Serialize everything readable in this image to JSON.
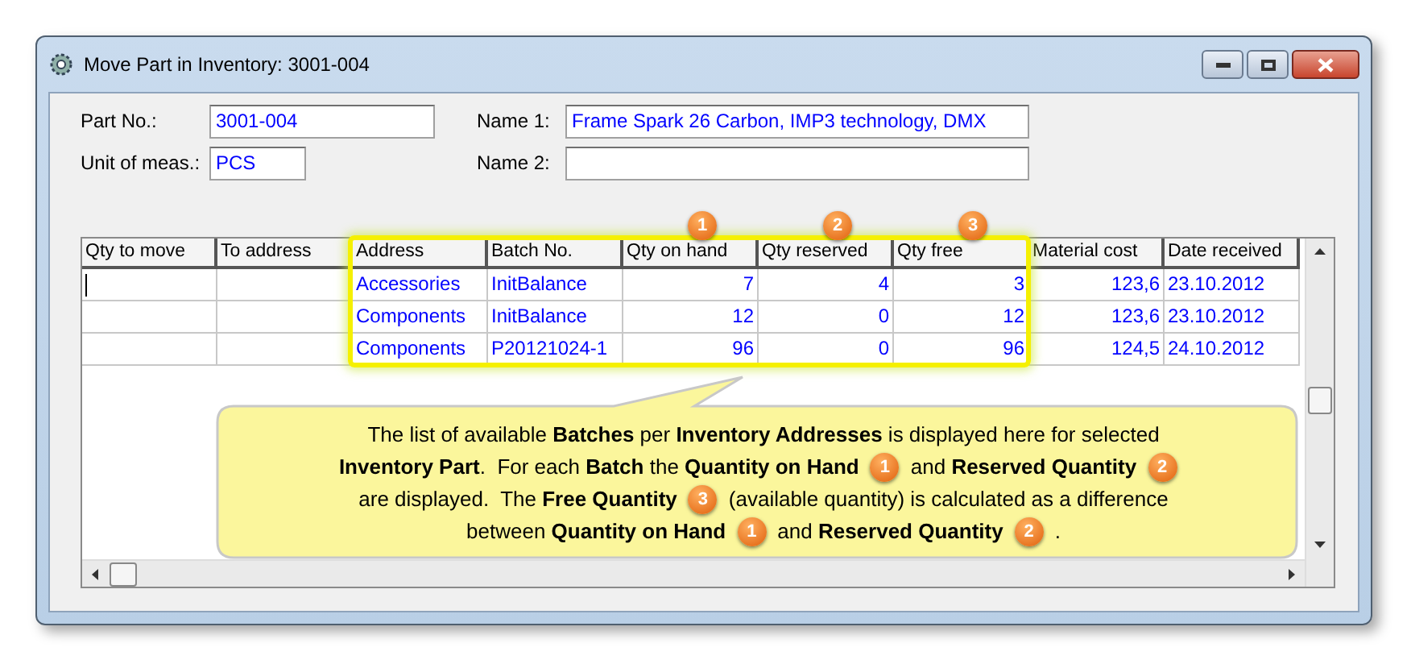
{
  "window": {
    "title": "Move Part in Inventory: 3001-004"
  },
  "left_fields": [
    {
      "label": "Part No.:",
      "value": "3001-004"
    },
    {
      "label": "Unit of meas.:",
      "value": "PCS"
    }
  ],
  "right_fields": [
    {
      "label": "Name 1:",
      "value": "Frame Spark 26 Carbon, IMP3 technology, DMX"
    },
    {
      "label": "Name 2:"
    }
  ],
  "table": {
    "columns": [
      {
        "label": "Qty to move",
        "kind": "text",
        "highlighted": false
      },
      {
        "label": "To address",
        "kind": "text",
        "highlighted": false
      },
      {
        "label": "Address",
        "kind": "text",
        "highlighted": true
      },
      {
        "label": "Batch No.",
        "kind": "text",
        "highlighted": true
      },
      {
        "label": "Qty on hand",
        "kind": "number",
        "highlighted": true,
        "badge": "1"
      },
      {
        "label": "Qty reserved",
        "kind": "number",
        "highlighted": true,
        "badge": "2"
      },
      {
        "label": "Qty free",
        "kind": "number",
        "highlighted": true,
        "badge": "3"
      },
      {
        "label": "Material cost",
        "kind": "number",
        "highlighted": false
      },
      {
        "label": "Date received",
        "kind": "text",
        "highlighted": false
      }
    ],
    "rows": [
      {
        "focused": true,
        "cells": [
          null,
          null,
          "Accessories",
          "InitBalance",
          "7",
          "4",
          "3",
          "123,6",
          "23.10.2012"
        ]
      },
      {
        "focused": false,
        "cells": [
          null,
          null,
          "Components",
          "InitBalance",
          "12",
          "0",
          "12",
          "123,6",
          "23.10.2012"
        ]
      },
      {
        "focused": false,
        "cells": [
          null,
          null,
          "Components",
          "P20121024-1",
          "96",
          "0",
          "96",
          "124,5",
          "24.10.2012"
        ]
      }
    ]
  },
  "callout": {
    "lines": [
      [
        {
          "kind": "text",
          "text": "The list of available **Batches** per **Inventory Addresses** is displayed here for selected"
        }
      ],
      [
        {
          "kind": "text",
          "text": "**Inventory Part**.  For each **Batch** the **Quantity on Hand**"
        },
        {
          "kind": "badge",
          "text": "1"
        },
        {
          "kind": "text",
          "text": "and **Reserved Quantity**"
        },
        {
          "kind": "badge",
          "text": "2"
        }
      ],
      [
        {
          "kind": "text",
          "text": "are displayed.  The **Free Quantity**"
        },
        {
          "kind": "badge",
          "text": "3"
        },
        {
          "kind": "text",
          "text": "(available quantity) is calculated as a difference"
        }
      ],
      [
        {
          "kind": "text",
          "text": "between **Quantity on Hand**"
        },
        {
          "kind": "badge",
          "text": "1"
        },
        {
          "kind": "text",
          "text": "and **Reserved Quantity**"
        },
        {
          "kind": "badge",
          "text": "2"
        },
        {
          "kind": "text",
          "text": "."
        }
      ]
    ]
  }
}
